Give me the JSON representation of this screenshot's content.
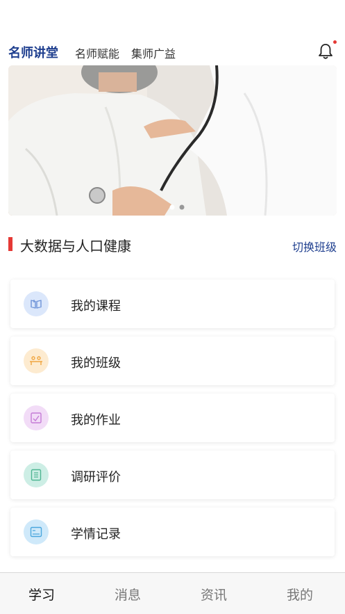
{
  "header": {
    "tabs": [
      {
        "label": "名师讲堂",
        "active": true
      },
      {
        "label": "名师赋能",
        "active": false
      },
      {
        "label": "集师广益",
        "active": false
      }
    ],
    "notification_icon": "bell-icon",
    "notification_badge_color": "#e53935",
    "accent_color": "#1f3f8f"
  },
  "banner": {
    "image": "doctor-stethoscope-elderly-patient",
    "carousel_pages": 2,
    "active_page": 2
  },
  "section": {
    "title": "大数据与人口健康",
    "switch_label": "切换班级",
    "marker_color": "#e53935"
  },
  "menu": [
    {
      "label": "我的课程",
      "icon": "book-icon",
      "color": "#dbe7fb",
      "stroke": "#6d93d8"
    },
    {
      "label": "我的班级",
      "icon": "class-icon",
      "color": "#fdebd0",
      "stroke": "#f0a640"
    },
    {
      "label": "我的作业",
      "icon": "homework-icon",
      "color": "#f2dcf7",
      "stroke": "#c57bd6"
    },
    {
      "label": "调研评价",
      "icon": "survey-icon",
      "color": "#cdeee5",
      "stroke": "#4fb592"
    },
    {
      "label": "学情记录",
      "icon": "record-icon",
      "color": "#cfe9fa",
      "stroke": "#4aa6dd"
    }
  ],
  "bottom_nav": [
    {
      "label": "学习",
      "active": true
    },
    {
      "label": "消息",
      "active": false
    },
    {
      "label": "资讯",
      "active": false
    },
    {
      "label": "我的",
      "active": false
    }
  ]
}
